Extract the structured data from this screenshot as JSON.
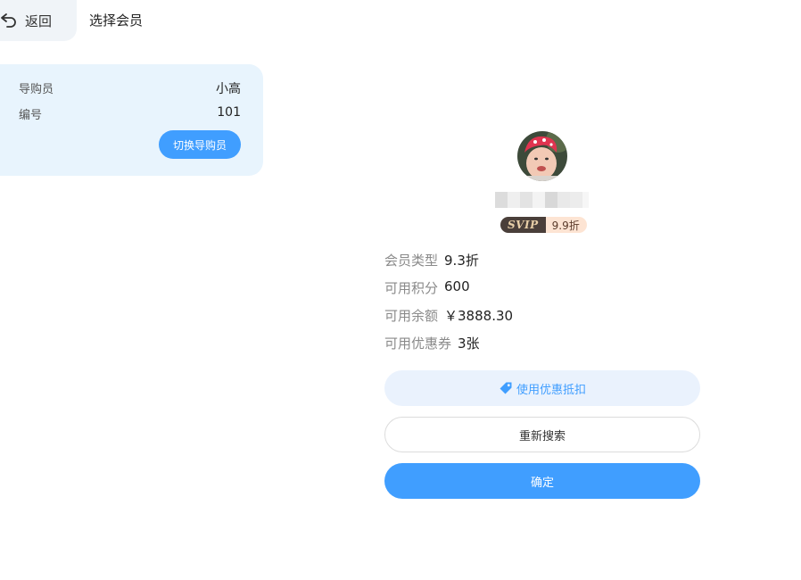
{
  "header": {
    "back_label": "返回",
    "title": "选择会员"
  },
  "guide": {
    "rows": [
      {
        "label": "导购员",
        "value": "小高"
      },
      {
        "label": "编号",
        "value": "101"
      }
    ],
    "switch_label": "切换导购员"
  },
  "member": {
    "badge_level": "SVIP",
    "badge_discount": "9.9折",
    "info": [
      {
        "label": "会员类型",
        "value": "9.3折"
      },
      {
        "label": "可用积分",
        "value": "600"
      },
      {
        "label": "可用余额",
        "value": "￥3888.30"
      },
      {
        "label": "可用优惠券",
        "value": "3张"
      }
    ]
  },
  "actions": {
    "coupon_label": "使用优惠抵扣",
    "research_label": "重新搜索",
    "confirm_label": "确定"
  },
  "colors": {
    "primary": "#409eff",
    "card_bg": "#e8f4fd",
    "badge_dark": "#4a3f3a",
    "badge_light": "#fde4d3"
  }
}
